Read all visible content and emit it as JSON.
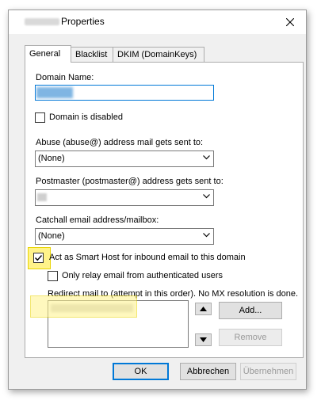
{
  "window": {
    "title": "Properties",
    "close_glyph": "✕"
  },
  "tabs": [
    {
      "label": "General"
    },
    {
      "label": "Blacklist"
    },
    {
      "label": "DKIM (DomainKeys)"
    }
  ],
  "general": {
    "domain_name_label": "Domain Name:",
    "domain_disabled_label": "Domain is disabled",
    "abuse_label": "Abuse (abuse@) address mail gets sent to:",
    "abuse_value": "(None)",
    "postmaster_label": "Postmaster (postmaster@) address gets sent to:",
    "catchall_label": "Catchall email address/mailbox:",
    "catchall_value": "(None)",
    "smarthost_label": "Act as Smart Host for inbound email to this domain",
    "smarthost_checked": true,
    "relay_auth_label": "Only relay email from authenticated users",
    "relay_auth_checked": false,
    "redirect_label": "Redirect mail to (attempt in this order). No MX resolution is done.",
    "add_button": "Add...",
    "remove_button": "Remove"
  },
  "footer": {
    "ok_button": "OK",
    "cancel_button": "Abbrechen",
    "apply_button": "Übernehmen"
  },
  "colors": {
    "highlight": "#fff38a",
    "focus_border": "#0078d7"
  },
  "icons": [
    "close-icon",
    "chevron-down-icon",
    "checkmark-icon",
    "arrow-up-icon",
    "arrow-down-icon"
  ]
}
